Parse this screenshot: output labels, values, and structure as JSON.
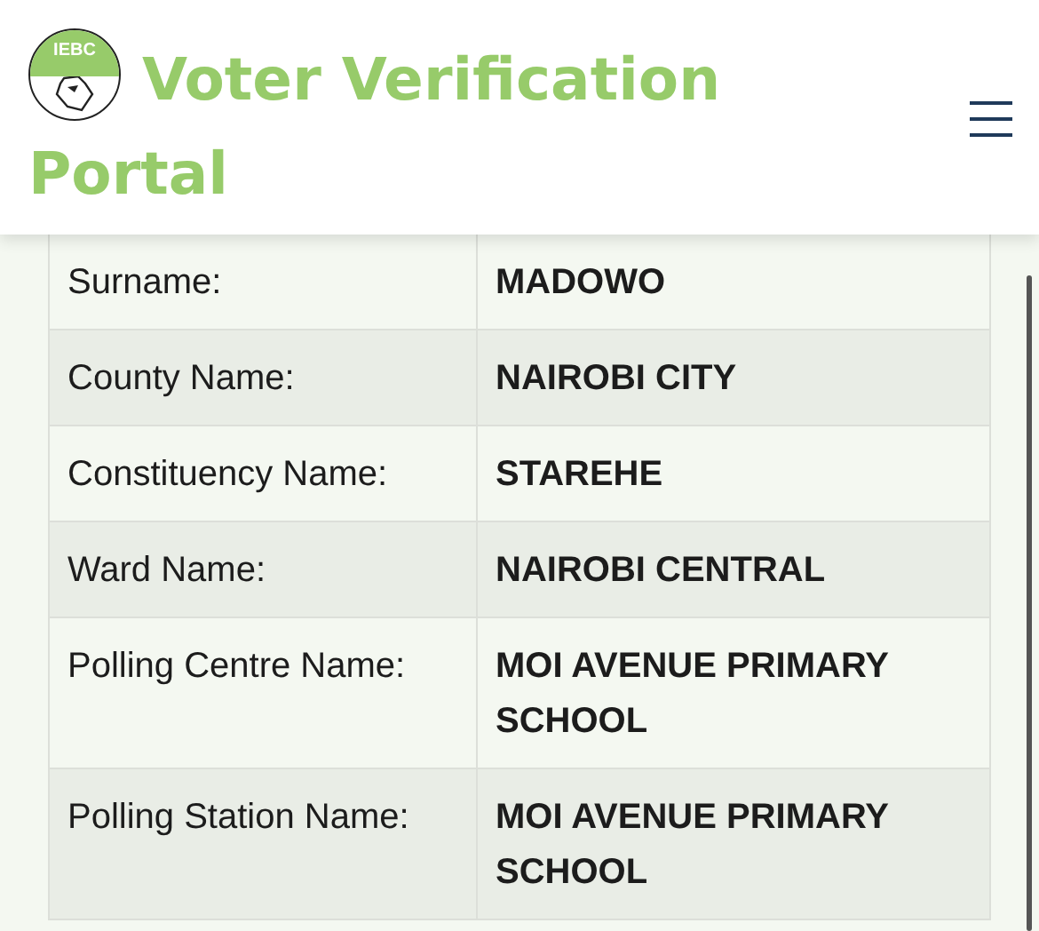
{
  "header": {
    "logo_text": "IEBC",
    "title": "Voter Verification Portal"
  },
  "details": [
    {
      "label": "Surname:",
      "value": "MADOWO"
    },
    {
      "label": "County Name:",
      "value": "NAIROBI CITY"
    },
    {
      "label": "Constituency Name:",
      "value": "STAREHE"
    },
    {
      "label": "Ward Name:",
      "value": "NAIROBI CENTRAL"
    },
    {
      "label": "Polling Centre Name:",
      "value": "MOI AVENUE PRIMARY SCHOOL"
    },
    {
      "label": "Polling Station Name:",
      "value": "MOI AVENUE PRIMARY SCHOOL"
    }
  ]
}
